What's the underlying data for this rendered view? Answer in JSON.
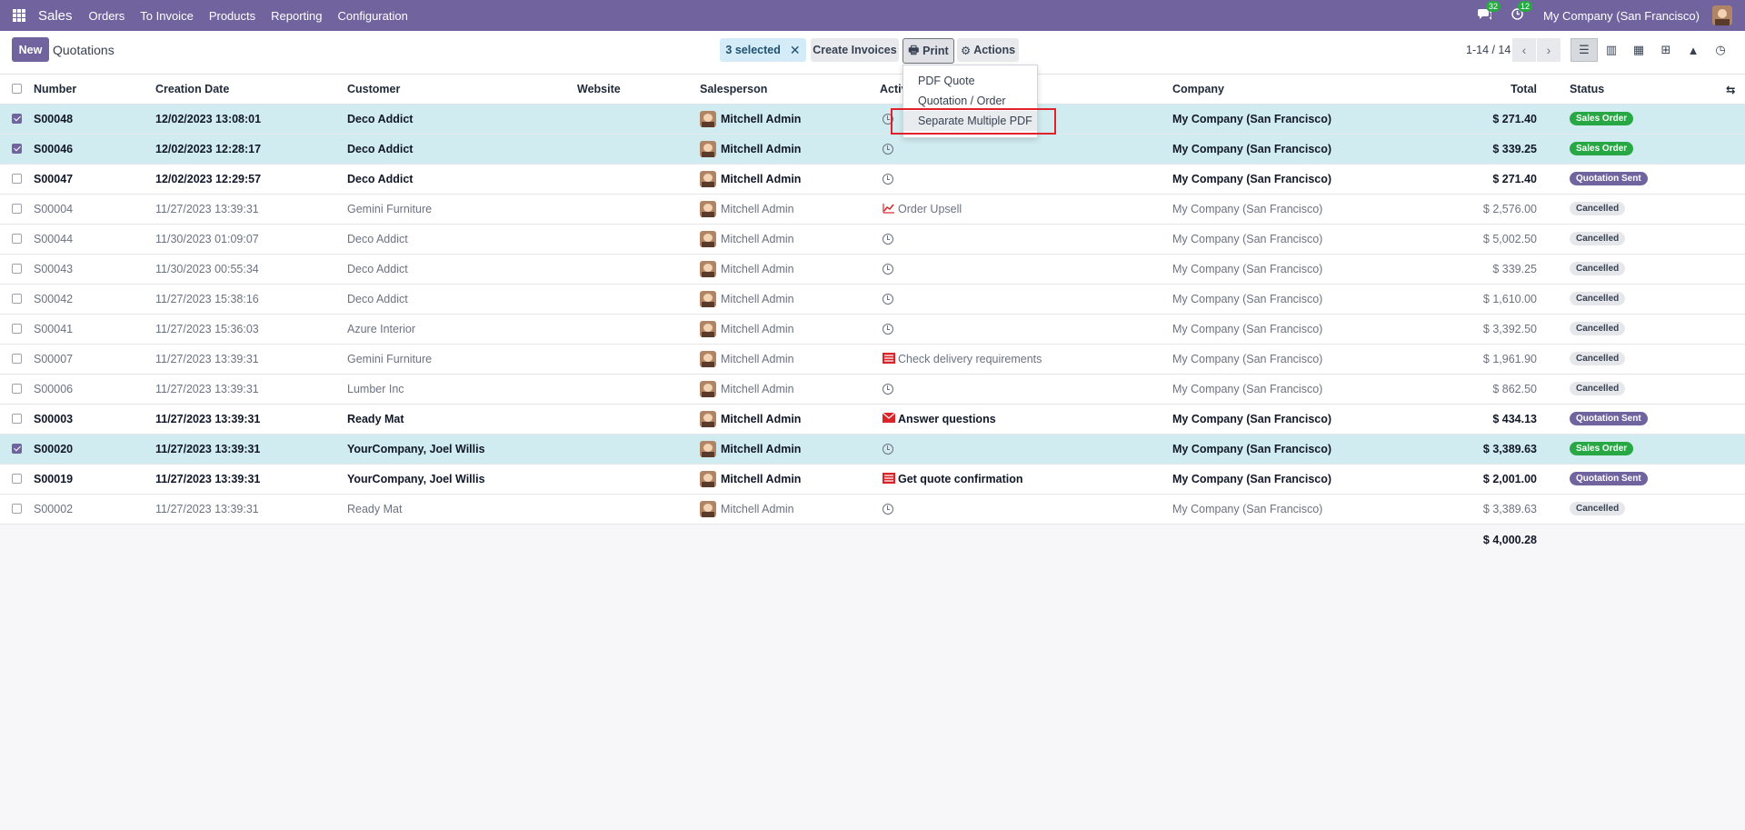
{
  "topbar": {
    "app_name": "Sales",
    "menu": [
      "Orders",
      "To Invoice",
      "Products",
      "Reporting",
      "Configuration"
    ],
    "messages_count": "32",
    "activities_count": "12",
    "company": "My Company (San Francisco)"
  },
  "control": {
    "new_label": "New",
    "breadcrumb": "Quotations",
    "selected_label": "3 selected",
    "create_invoices_label": "Create Invoices",
    "print_label": "Print",
    "actions_label": "Actions",
    "pager": "1-14 / 14"
  },
  "print_menu": {
    "items": [
      "PDF Quote",
      "Quotation / Order",
      "Separate Multiple PDF"
    ]
  },
  "table": {
    "headers": {
      "number": "Number",
      "creation_date": "Creation Date",
      "customer": "Customer",
      "website": "Website",
      "salesperson": "Salesperson",
      "activities": "Activ",
      "company": "Company",
      "total": "Total",
      "status": "Status"
    },
    "rows": [
      {
        "number": "S00048",
        "date": "12/02/2023 13:08:01",
        "customer": "Deco Addict",
        "salesperson": "Mitchell Admin",
        "activity": "",
        "activity_icon": "clock-icon",
        "company": "My Company (San Francisco)",
        "total": "$ 271.40",
        "status": "Sales Order",
        "selected": true
      },
      {
        "number": "S00046",
        "date": "12/02/2023 12:28:17",
        "customer": "Deco Addict",
        "salesperson": "Mitchell Admin",
        "activity": "",
        "activity_icon": "clock-icon",
        "company": "My Company (San Francisco)",
        "total": "$ 339.25",
        "status": "Sales Order",
        "selected": true
      },
      {
        "number": "S00047",
        "date": "12/02/2023 12:29:57",
        "customer": "Deco Addict",
        "salesperson": "Mitchell Admin",
        "activity": "",
        "activity_icon": "clock-icon",
        "company": "My Company (San Francisco)",
        "total": "$ 271.40",
        "status": "Quotation Sent",
        "selected": false
      },
      {
        "number": "S00004",
        "date": "11/27/2023 13:39:31",
        "customer": "Gemini Furniture",
        "salesperson": "Mitchell Admin",
        "activity": "Order Upsell",
        "activity_icon": "chart-line-icon",
        "company": "My Company (San Francisco)",
        "total": "$ 2,576.00",
        "status": "Cancelled",
        "selected": false
      },
      {
        "number": "S00044",
        "date": "11/30/2023 01:09:07",
        "customer": "Deco Addict",
        "salesperson": "Mitchell Admin",
        "activity": "",
        "activity_icon": "clock-icon",
        "company": "My Company (San Francisco)",
        "total": "$ 5,002.50",
        "status": "Cancelled",
        "selected": false
      },
      {
        "number": "S00043",
        "date": "11/30/2023 00:55:34",
        "customer": "Deco Addict",
        "salesperson": "Mitchell Admin",
        "activity": "",
        "activity_icon": "clock-icon",
        "company": "My Company (San Francisco)",
        "total": "$ 339.25",
        "status": "Cancelled",
        "selected": false
      },
      {
        "number": "S00042",
        "date": "11/27/2023 15:38:16",
        "customer": "Deco Addict",
        "salesperson": "Mitchell Admin",
        "activity": "",
        "activity_icon": "clock-icon",
        "company": "My Company (San Francisco)",
        "total": "$ 1,610.00",
        "status": "Cancelled",
        "selected": false
      },
      {
        "number": "S00041",
        "date": "11/27/2023 15:36:03",
        "customer": "Azure Interior",
        "salesperson": "Mitchell Admin",
        "activity": "",
        "activity_icon": "clock-icon",
        "company": "My Company (San Francisco)",
        "total": "$ 3,392.50",
        "status": "Cancelled",
        "selected": false
      },
      {
        "number": "S00007",
        "date": "11/27/2023 13:39:31",
        "customer": "Gemini Furniture",
        "salesperson": "Mitchell Admin",
        "activity": "Check delivery requirements",
        "activity_icon": "tasks-icon",
        "company": "My Company (San Francisco)",
        "total": "$ 1,961.90",
        "status": "Cancelled",
        "selected": false
      },
      {
        "number": "S00006",
        "date": "11/27/2023 13:39:31",
        "customer": "Lumber Inc",
        "salesperson": "Mitchell Admin",
        "activity": "",
        "activity_icon": "clock-icon",
        "company": "My Company (San Francisco)",
        "total": "$ 862.50",
        "status": "Cancelled",
        "selected": false
      },
      {
        "number": "S00003",
        "date": "11/27/2023 13:39:31",
        "customer": "Ready Mat",
        "salesperson": "Mitchell Admin",
        "activity": "Answer questions",
        "activity_icon": "envelope-icon",
        "company": "My Company (San Francisco)",
        "total": "$ 434.13",
        "status": "Quotation Sent",
        "selected": false
      },
      {
        "number": "S00020",
        "date": "11/27/2023 13:39:31",
        "customer": "YourCompany, Joel Willis",
        "salesperson": "Mitchell Admin",
        "activity": "",
        "activity_icon": "clock-icon",
        "company": "My Company (San Francisco)",
        "total": "$ 3,389.63",
        "status": "Sales Order",
        "selected": true
      },
      {
        "number": "S00019",
        "date": "11/27/2023 13:39:31",
        "customer": "YourCompany, Joel Willis",
        "salesperson": "Mitchell Admin",
        "activity": "Get quote confirmation",
        "activity_icon": "tasks-icon",
        "company": "My Company (San Francisco)",
        "total": "$ 2,001.00",
        "status": "Quotation Sent",
        "selected": false
      },
      {
        "number": "S00002",
        "date": "11/27/2023 13:39:31",
        "customer": "Ready Mat",
        "salesperson": "Mitchell Admin",
        "activity": "",
        "activity_icon": "clock-icon",
        "company": "My Company (San Francisco)",
        "total": "$ 3,389.63",
        "status": "Cancelled",
        "selected": false
      }
    ],
    "sum_total": "$ 4,000.28"
  },
  "colors": {
    "brand": "#71639e",
    "selected_row": "#d1ecf1",
    "sales_order": "#28a745",
    "highlight_outline": "#e0222a"
  }
}
